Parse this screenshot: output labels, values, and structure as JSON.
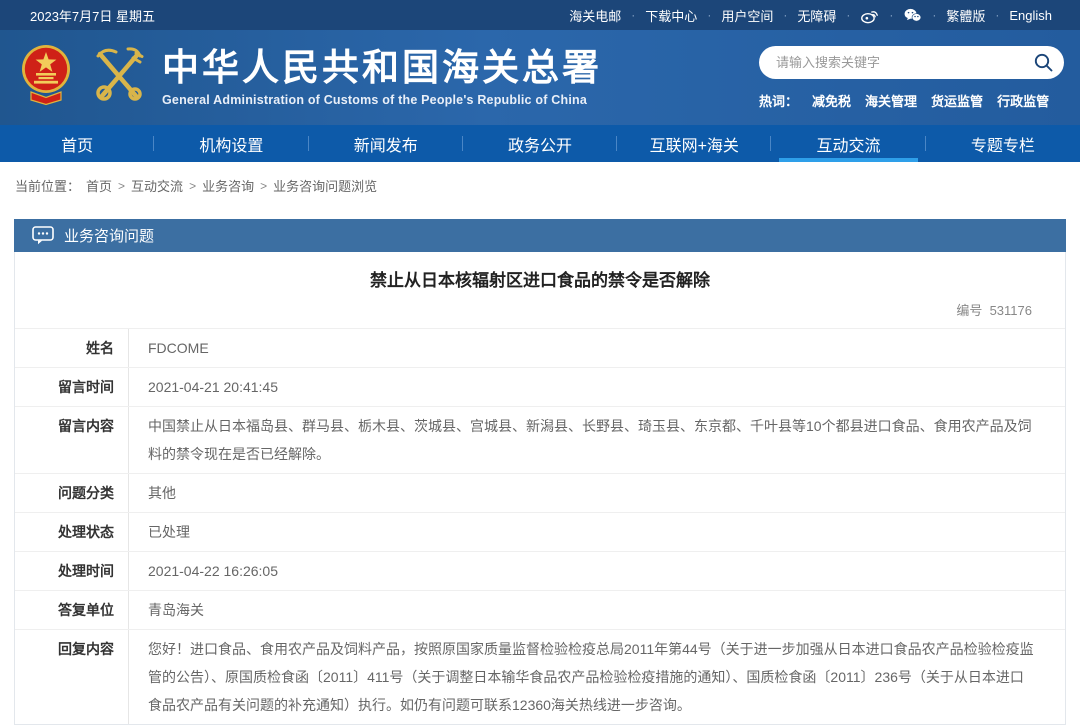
{
  "colors": {
    "topbar_bg": "#1c4679",
    "header_bg": "#2b67ab",
    "nav_bg": "#0d5aa9",
    "nav_active_underline": "#2e9fe9",
    "panel_header_bg": "#3c6fa2",
    "emblem_red": "#cf2117",
    "emblem_gold": "#e0b43c"
  },
  "icons": {
    "weibo": "weibo-icon",
    "wechat": "wechat-icon",
    "search": "search-icon",
    "chat_bubble": "chat-bubble-icon",
    "national_emblem": "national-emblem",
    "customs_key_emblem": "customs-key-emblem"
  },
  "topbar": {
    "date": "2023年7月7日 星期五",
    "dot": "·",
    "links": [
      "海关电邮",
      "下载中心",
      "用户空间",
      "无障碍"
    ],
    "lang_links": [
      "繁體版",
      "English"
    ]
  },
  "header": {
    "title": "中华人民共和国海关总署",
    "subtitle": "General Administration of Customs of the People's Republic of China",
    "search": {
      "placeholder": "请输入搜索关键字"
    },
    "hotwords": {
      "label": "热词：",
      "items": [
        "减免税",
        "海关管理",
        "货运监管",
        "行政监管"
      ]
    }
  },
  "nav": {
    "items": [
      {
        "label": "首页",
        "active": false
      },
      {
        "label": "机构设置",
        "active": false
      },
      {
        "label": "新闻发布",
        "active": false
      },
      {
        "label": "政务公开",
        "active": false
      },
      {
        "label": "互联网+海关",
        "active": false
      },
      {
        "label": "互动交流",
        "active": true
      },
      {
        "label": "专题专栏",
        "active": false
      }
    ]
  },
  "breadcrumb": {
    "prefix": "当前位置：",
    "separator": ">",
    "items": [
      "首页",
      "互动交流",
      "业务咨询",
      "业务咨询问题浏览"
    ]
  },
  "panel": {
    "header_title": "业务咨询问题",
    "question_title": "禁止从日本核辐射区进口食品的禁令是否解除",
    "number_label": "编号",
    "number": "531176",
    "rows": [
      {
        "label": "姓名",
        "value": "FDCOME"
      },
      {
        "label": "留言时间",
        "value": "2021-04-21 20:41:45"
      },
      {
        "label": "留言内容",
        "value": "中国禁止从日本福岛县、群马县、栃木县、茨城县、宫城县、新潟县、长野县、琦玉县、东京都、千叶县等10个都县进口食品、食用农产品及饲料的禁令现在是否已经解除。"
      },
      {
        "label": "问题分类",
        "value": "其他"
      },
      {
        "label": "处理状态",
        "value": "已处理"
      },
      {
        "label": "处理时间",
        "value": "2021-04-22 16:26:05"
      },
      {
        "label": "答复单位",
        "value": "青岛海关"
      },
      {
        "label": "回复内容",
        "value": "您好！进口食品、食用农产品及饲料产品，按照原国家质量监督检验检疫总局2011年第44号（关于进一步加强从日本进口食品农产品检验检疫监管的公告）、原国质检食函〔2011〕411号（关于调整日本输华食品农产品检验检疫措施的通知）、国质检食函〔2011〕236号（关于从日本进口食品农产品有关问题的补充通知）执行。如仍有问题可联系12360海关热线进一步咨询。"
      }
    ]
  }
}
